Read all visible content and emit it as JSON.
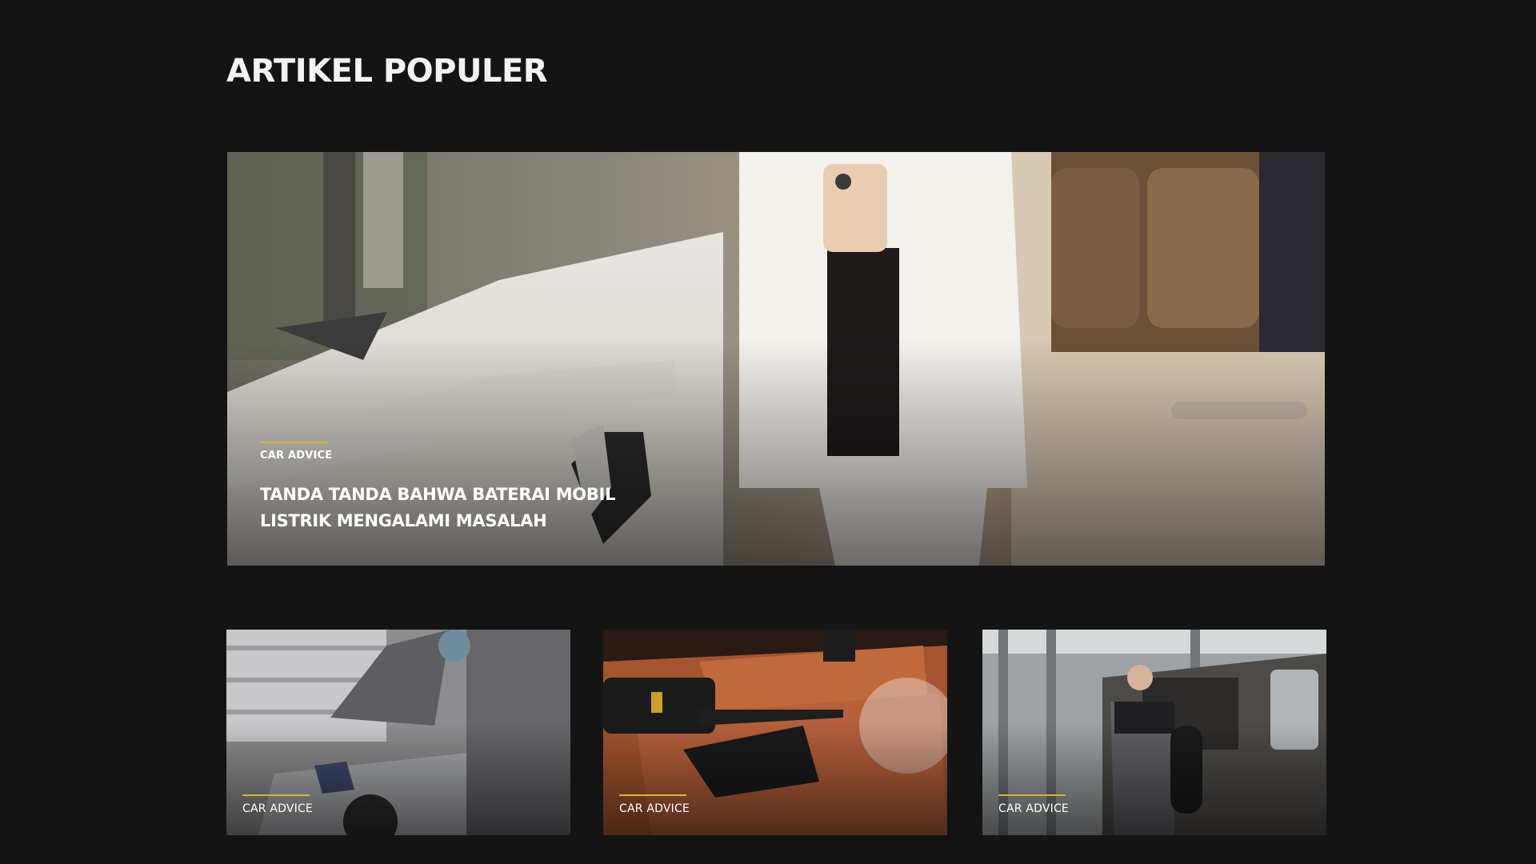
{
  "section": {
    "title": "ARTIKEL POPULER"
  },
  "theme": {
    "background": "#141414",
    "accent": "#d4b63a"
  },
  "featured": {
    "category": "CAR ADVICE",
    "title": "TANDA TANDA BAHWA BATERAI MOBIL LISTRIK MENGALAMI MASALAH",
    "image": "woman-charging-electric-car-photo"
  },
  "articles": [
    {
      "category": "CAR ADVICE",
      "image": "mechanic-under-car-hood-photo"
    },
    {
      "category": "CAR ADVICE",
      "image": "steam-cleaning-leather-seat-photo"
    },
    {
      "category": "CAR ADVICE",
      "image": "mechanic-carrying-tire-photo"
    }
  ]
}
